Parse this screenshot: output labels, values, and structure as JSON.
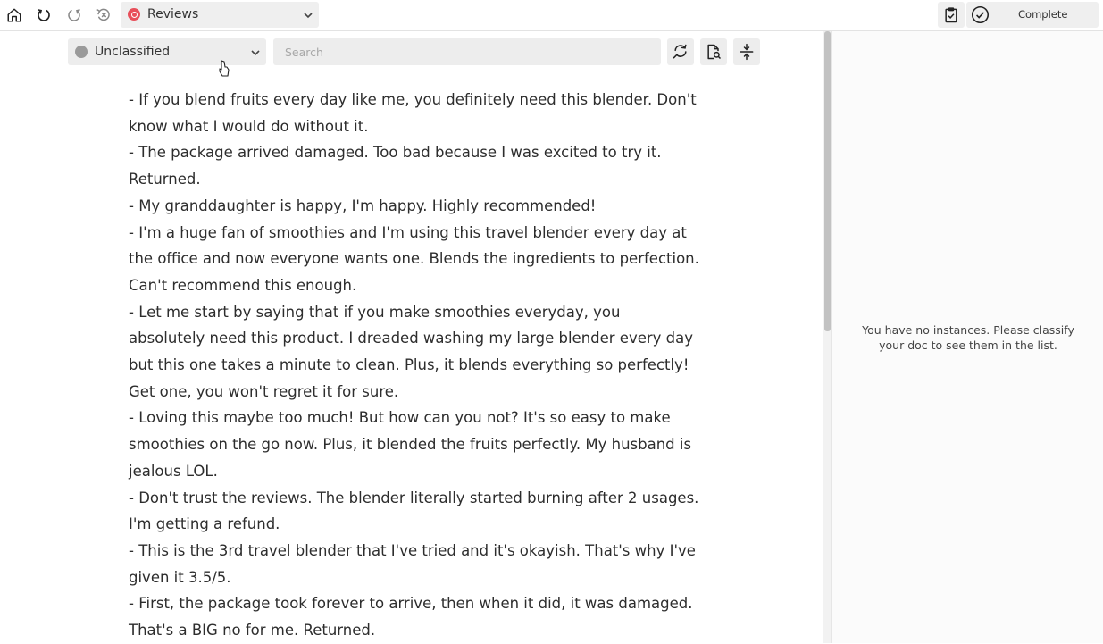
{
  "topbar": {
    "project": {
      "name": "Reviews",
      "color": "#e8505b"
    },
    "complete_label": "Complete"
  },
  "toolbar": {
    "classification": {
      "label": "Unclassified",
      "color": "#9a9a9a"
    },
    "search": {
      "placeholder": "Search",
      "value": ""
    }
  },
  "document": {
    "lines": [
      "- If you blend fruits every day like me, you definitely need this blender. Don't know what I would do without it.",
      "- The package arrived damaged. Too bad because I was excited to try it. Returned.",
      "- My granddaughter is happy, I'm happy. Highly recommended!",
      "- I'm a huge fan of smoothies and I'm using this travel blender every day at the office and now everyone wants one. Blends the ingredients to perfection. Can't recommend this enough.",
      "- Let me start by saying that if you make smoothies everyday, you absolutely need this product. I dreaded washing my large blender every day but this one takes a minute to clean. Plus, it blends everything so perfectly! Get one, you won't regret it for sure.",
      "- Loving this maybe too much! But how can you not? It's so easy to make smoothies on the go now. Plus, it blended the fruits perfectly. My husband is jealous LOL.",
      "- Don't trust the reviews. The blender literally started burning after 2 usages. I'm getting a refund.",
      "- This is the 3rd travel blender that I've tried and it's okayish. That's why I've given it 3.5/5.",
      "- First, the package took forever to arrive, then when it did, it was damaged. That's a BIG no for me. Returned."
    ]
  },
  "side_panel": {
    "empty_message": "You have no instances. Please classify your doc to see them in the list."
  },
  "icons": [
    "home-icon",
    "undo-icon",
    "redo-icon",
    "reset-history-icon",
    "chevron-down-icon",
    "clipboard-check-icon",
    "check-circle-icon",
    "find-replace-icon",
    "document-search-icon",
    "collapse-icon",
    "mouse-cursor-icon"
  ]
}
